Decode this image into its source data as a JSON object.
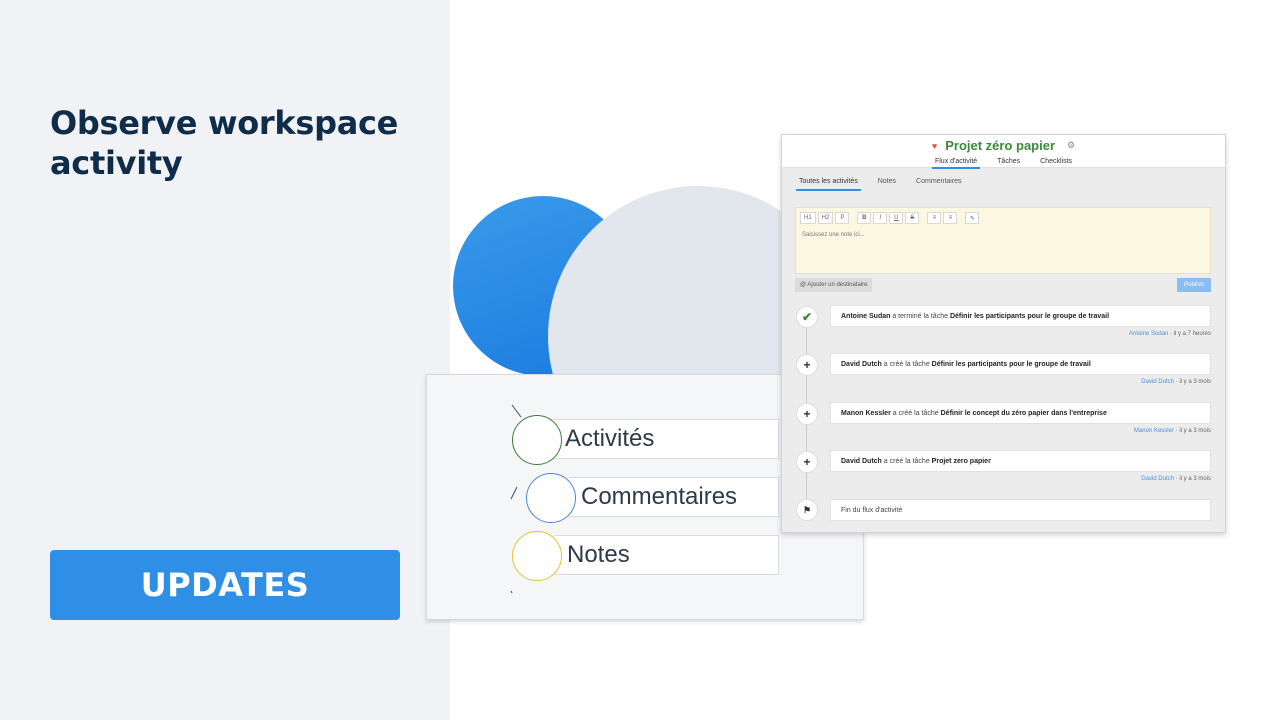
{
  "promo": {
    "headline": "Observe workspace activity",
    "badge": "UPDATES"
  },
  "mini_list": {
    "items": [
      {
        "label": "Activités",
        "color": "#3a7d3a"
      },
      {
        "label": "Commentaires",
        "color": "#4a86d8"
      },
      {
        "label": "Notes",
        "color": "#e8c22e"
      }
    ]
  },
  "app": {
    "title": "Projet zéro papier",
    "nav": [
      "Flux d'activité",
      "Tâches",
      "Checklists"
    ],
    "subtabs": [
      "Toutes les activités",
      "Notes",
      "Commentaires"
    ],
    "toolbar": [
      "H1",
      "H2",
      "P",
      "B",
      "I",
      "U",
      "S",
      "≡",
      "≡",
      "✎"
    ],
    "editor_placeholder": "Saisissez une note ici...",
    "add_recipient": "@ Ajouter un destinataire",
    "publish": "Publish",
    "activities": [
      {
        "icon": "check",
        "actor": "Antoine Sudan",
        "verb": "a terminé la tâche",
        "object": "Définir les participants pour le groupe de travail",
        "author": "Antoine Sudan",
        "time": "· il y a 7 heures"
      },
      {
        "icon": "plus",
        "actor": "David Dutch",
        "verb": "a créé la tâche",
        "object": "Définir les participants pour le groupe de travail",
        "author": "David Dutch",
        "time": "· il y a 3 mois"
      },
      {
        "icon": "plus",
        "actor": "Manon Kessler",
        "verb": "a créé la tâche",
        "object": "Définir le concept du zéro papier dans l'entreprise",
        "author": "Manon Kessler",
        "time": "· il y a 3 mois"
      },
      {
        "icon": "plus",
        "actor": "David Dutch",
        "verb": "a créé la tâche",
        "object": "Projet zero papier",
        "author": "David Dutch",
        "time": "· il y a 3 mois"
      }
    ],
    "end_label": "Fin du flux d'activité"
  }
}
